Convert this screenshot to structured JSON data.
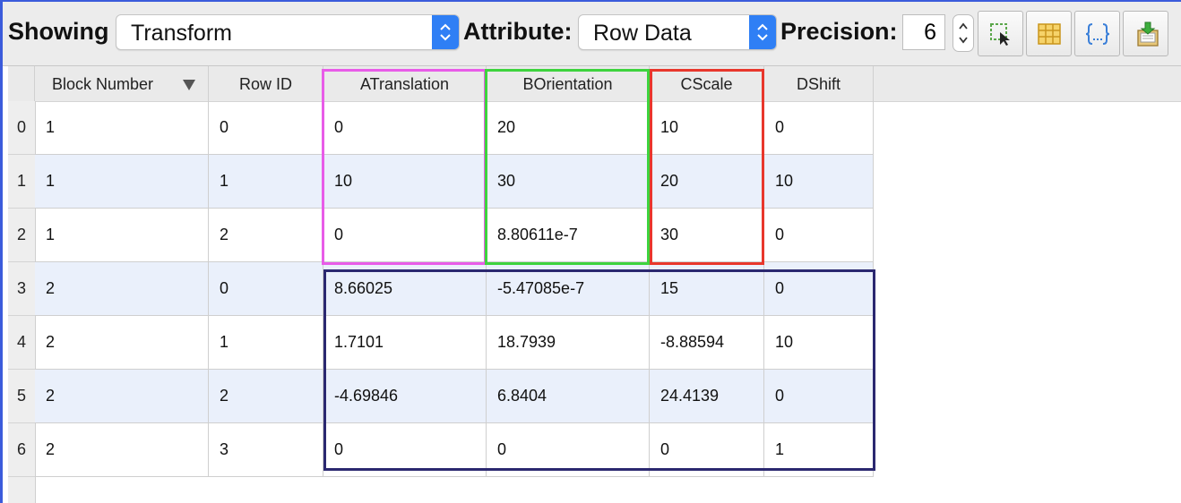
{
  "toolbar": {
    "showing_label": "Showing",
    "showing_value": "Transform",
    "attribute_label": "Attribute:",
    "attribute_value": "Row Data",
    "precision_label": "Precision:",
    "precision_value": "6",
    "buttons": [
      {
        "icon": "select-region-icon"
      },
      {
        "icon": "grid-icon"
      },
      {
        "icon": "braces-icon"
      },
      {
        "icon": "import-icon"
      }
    ]
  },
  "table": {
    "columns": [
      "Block Number",
      "Row ID",
      "ATranslation",
      "BOrientation",
      "CScale",
      "DShift"
    ],
    "sort_column": "Block Number",
    "row_numbers": [
      "0",
      "1",
      "2",
      "3",
      "4",
      "5",
      "6"
    ],
    "rows": [
      [
        "1",
        "0",
        "0",
        "20",
        "10",
        "0"
      ],
      [
        "1",
        "1",
        "10",
        "30",
        "20",
        "10"
      ],
      [
        "1",
        "2",
        "0",
        "8.80611e-7",
        "30",
        "0"
      ],
      [
        "2",
        "0",
        "8.66025",
        "-5.47085e-7",
        "15",
        "0"
      ],
      [
        "2",
        "1",
        "1.7101",
        "18.7939",
        "-8.88594",
        "10"
      ],
      [
        "2",
        "2",
        "-4.69846",
        "6.8404",
        "24.4139",
        "0"
      ],
      [
        "2",
        "3",
        "0",
        "0",
        "0",
        "1"
      ]
    ]
  },
  "highlight_colors": {
    "translation": "#e85ce8",
    "orientation": "#3ed33e",
    "scale": "#e8372c",
    "block2": "#2b2870"
  },
  "colors": {
    "accent": "#2f7ff5",
    "alt_row": "#eaf0fb",
    "header_bg": "#eaeaea"
  }
}
